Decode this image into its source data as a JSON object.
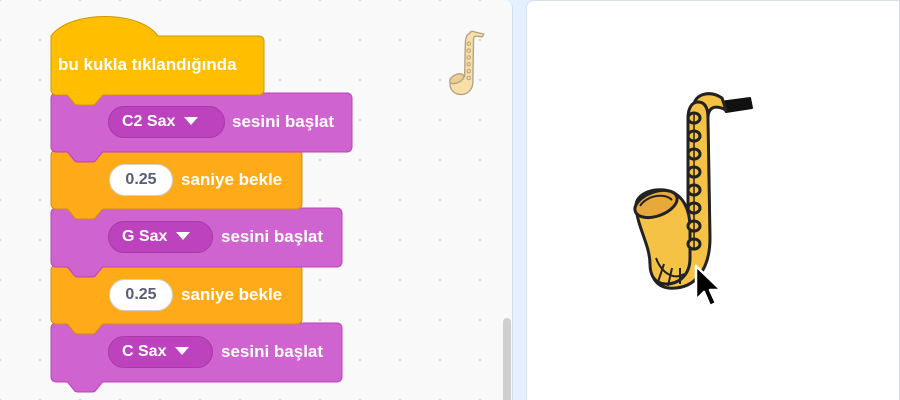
{
  "workspace": {
    "hat_block": {
      "label": "bu kukla tıklandığında"
    },
    "blocks": [
      {
        "type": "sound",
        "dropdown": "C2 Sax",
        "label": "sesini başlat"
      },
      {
        "type": "control",
        "value": "0.25",
        "label": "saniye bekle"
      },
      {
        "type": "sound",
        "dropdown": "G Sax",
        "label": "sesini başlat"
      },
      {
        "type": "control",
        "value": "0.25",
        "label": "saniye bekle"
      },
      {
        "type": "sound",
        "dropdown": "C Sax",
        "label": "sesini başlat"
      }
    ],
    "sprite_thumbnail_icon": "saxophone-icon"
  },
  "stage": {
    "sprite_icon": "saxophone-icon",
    "cursor_icon": "mouse-pointer-icon"
  },
  "colors": {
    "events": "#ffbf00",
    "events_border": "#cc9900",
    "sound": "#cf63cf",
    "sound_border": "#bd42bd",
    "control": "#ffab19",
    "control_border": "#cf8b17",
    "workspace_bg": "#f9f9f9"
  }
}
